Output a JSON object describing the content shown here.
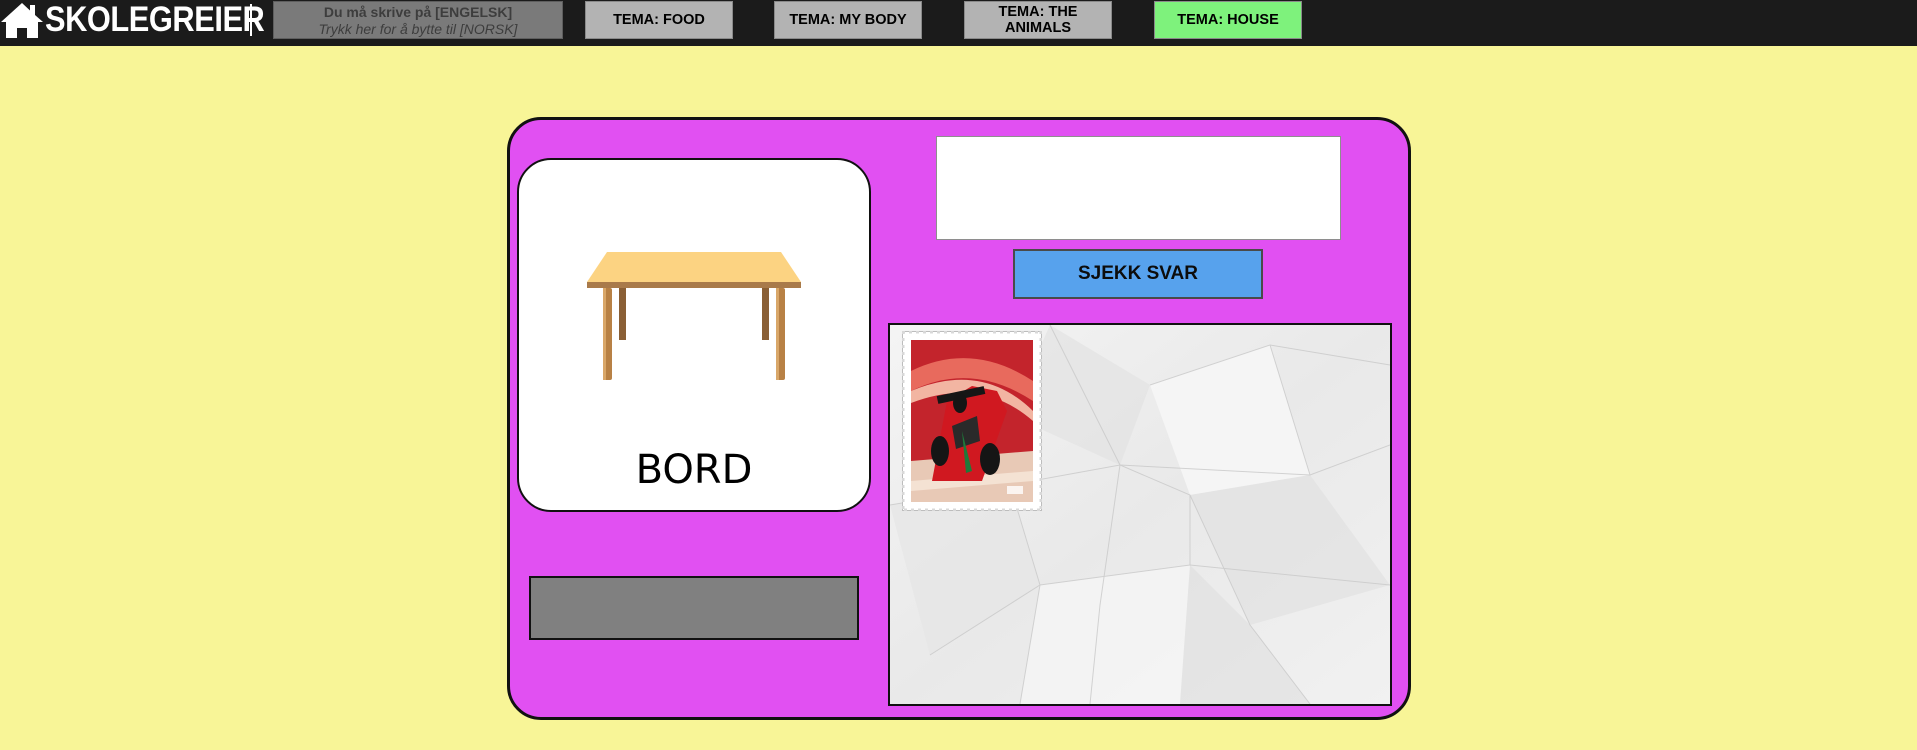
{
  "header": {
    "logo_text": "SKOLEGREIER",
    "logo_icon": "house-icon",
    "language_line1": "Du må skrive på [ENGELSK]",
    "language_line2": "Trykk her for å bytte til [NORSK]",
    "tabs": [
      {
        "label": "TEMA: FOOD",
        "active": false
      },
      {
        "label": "TEMA: MY BODY",
        "active": false
      },
      {
        "label": "TEMA: THE ANIMALS",
        "active": false
      },
      {
        "label": "TEMA: HOUSE",
        "active": true
      }
    ]
  },
  "main": {
    "word": "BORD",
    "word_image_icon": "table-icon",
    "answer_value": "",
    "answer_placeholder": "",
    "check_label": "SJEKK SVAR",
    "reward_stamp_icon": "race-car-stamp-icon"
  },
  "colors": {
    "background": "#f8f597",
    "topbar": "#1b1b1b",
    "card": "#e150f2",
    "active_tab": "#7ef27c",
    "inactive_tab": "#b3b3b3",
    "check_button": "#57a2ed",
    "feedback_box": "#808080"
  }
}
